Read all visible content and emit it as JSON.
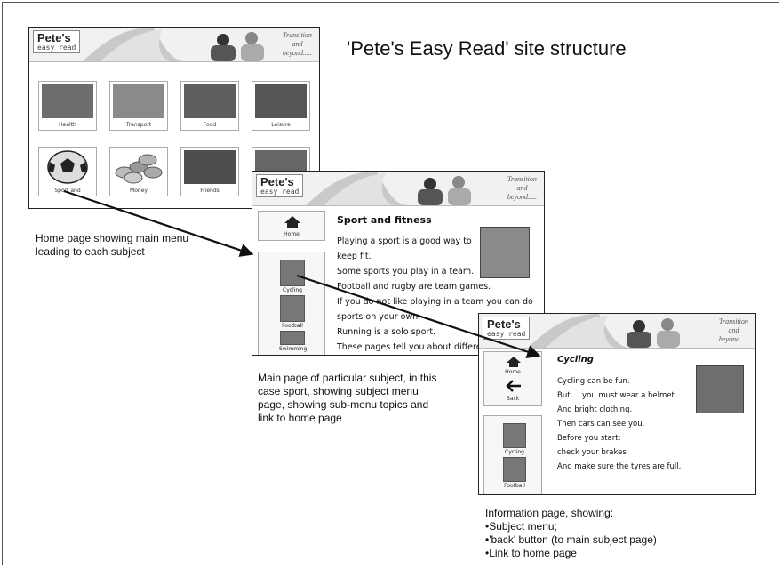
{
  "title": "'Pete's Easy Read' site structure",
  "logo": {
    "main": "Pete's",
    "sub": "easy read"
  },
  "tagline": [
    "Transition",
    "and",
    "beyond....."
  ],
  "home_page": {
    "tiles": [
      "Health",
      "Transport",
      "Food",
      "Leisure",
      "Sport and",
      "Money",
      "Friends",
      ""
    ]
  },
  "subject_page": {
    "nav_home": "Home",
    "menu": [
      "Cycling",
      "Football",
      "Swimming"
    ],
    "heading": "Sport and fitness",
    "lines": [
      "Playing a sport is a good way to",
      "keep fit.",
      "Some sports you play in a team.",
      "Football and rugby are team games.",
      "If you do not like playing in a team you can do",
      "sports on your own.",
      "Running is a solo sport.",
      "These pages tell you about differen"
    ]
  },
  "info_page": {
    "nav_home": "Home",
    "nav_back": "Back",
    "menu": [
      "Cycling",
      "Football"
    ],
    "heading": "Cycling",
    "lines": [
      "Cycling can be fun.",
      "But ... you must wear a helmet",
      "And bright clothing.",
      "Then cars can see you.",
      "Before you start:",
      "check your brakes",
      "And make sure the tyres are full."
    ]
  },
  "captions": {
    "home": [
      "Home page showing main menu",
      "leading to each subject"
    ],
    "subject": [
      "Main page of particular subject, in this",
      "case sport, showing subject menu",
      "page, showing sub-menu topics and",
      "link to home page"
    ],
    "info_intro": "Information page, showing:",
    "info_bullets": [
      "Subject menu;",
      "'back' button (to main subject page)",
      "Link to home page"
    ]
  }
}
